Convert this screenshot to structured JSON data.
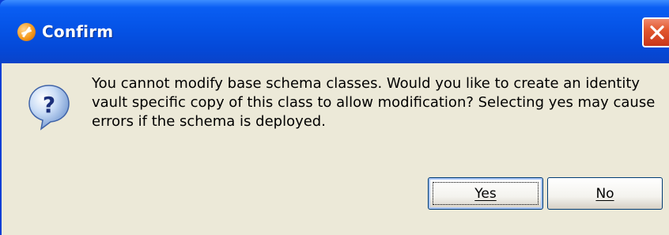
{
  "window": {
    "title": "Confirm"
  },
  "dialog": {
    "message": "You cannot modify base schema classes.  Would you like to create an identity\nvault specific copy of this class to allow modification?  Selecting yes may cause\nerrors if the schema is deployed."
  },
  "buttons": {
    "yes_label": "Yes",
    "no_label": "No"
  },
  "icons": {
    "title": "app-icon",
    "close": "close-icon",
    "message": "question-icon"
  },
  "colors": {
    "titlebar": "#0553e6",
    "client_background": "#ece9d8",
    "close_button": "#e2582f",
    "button_border": "#003c74"
  }
}
